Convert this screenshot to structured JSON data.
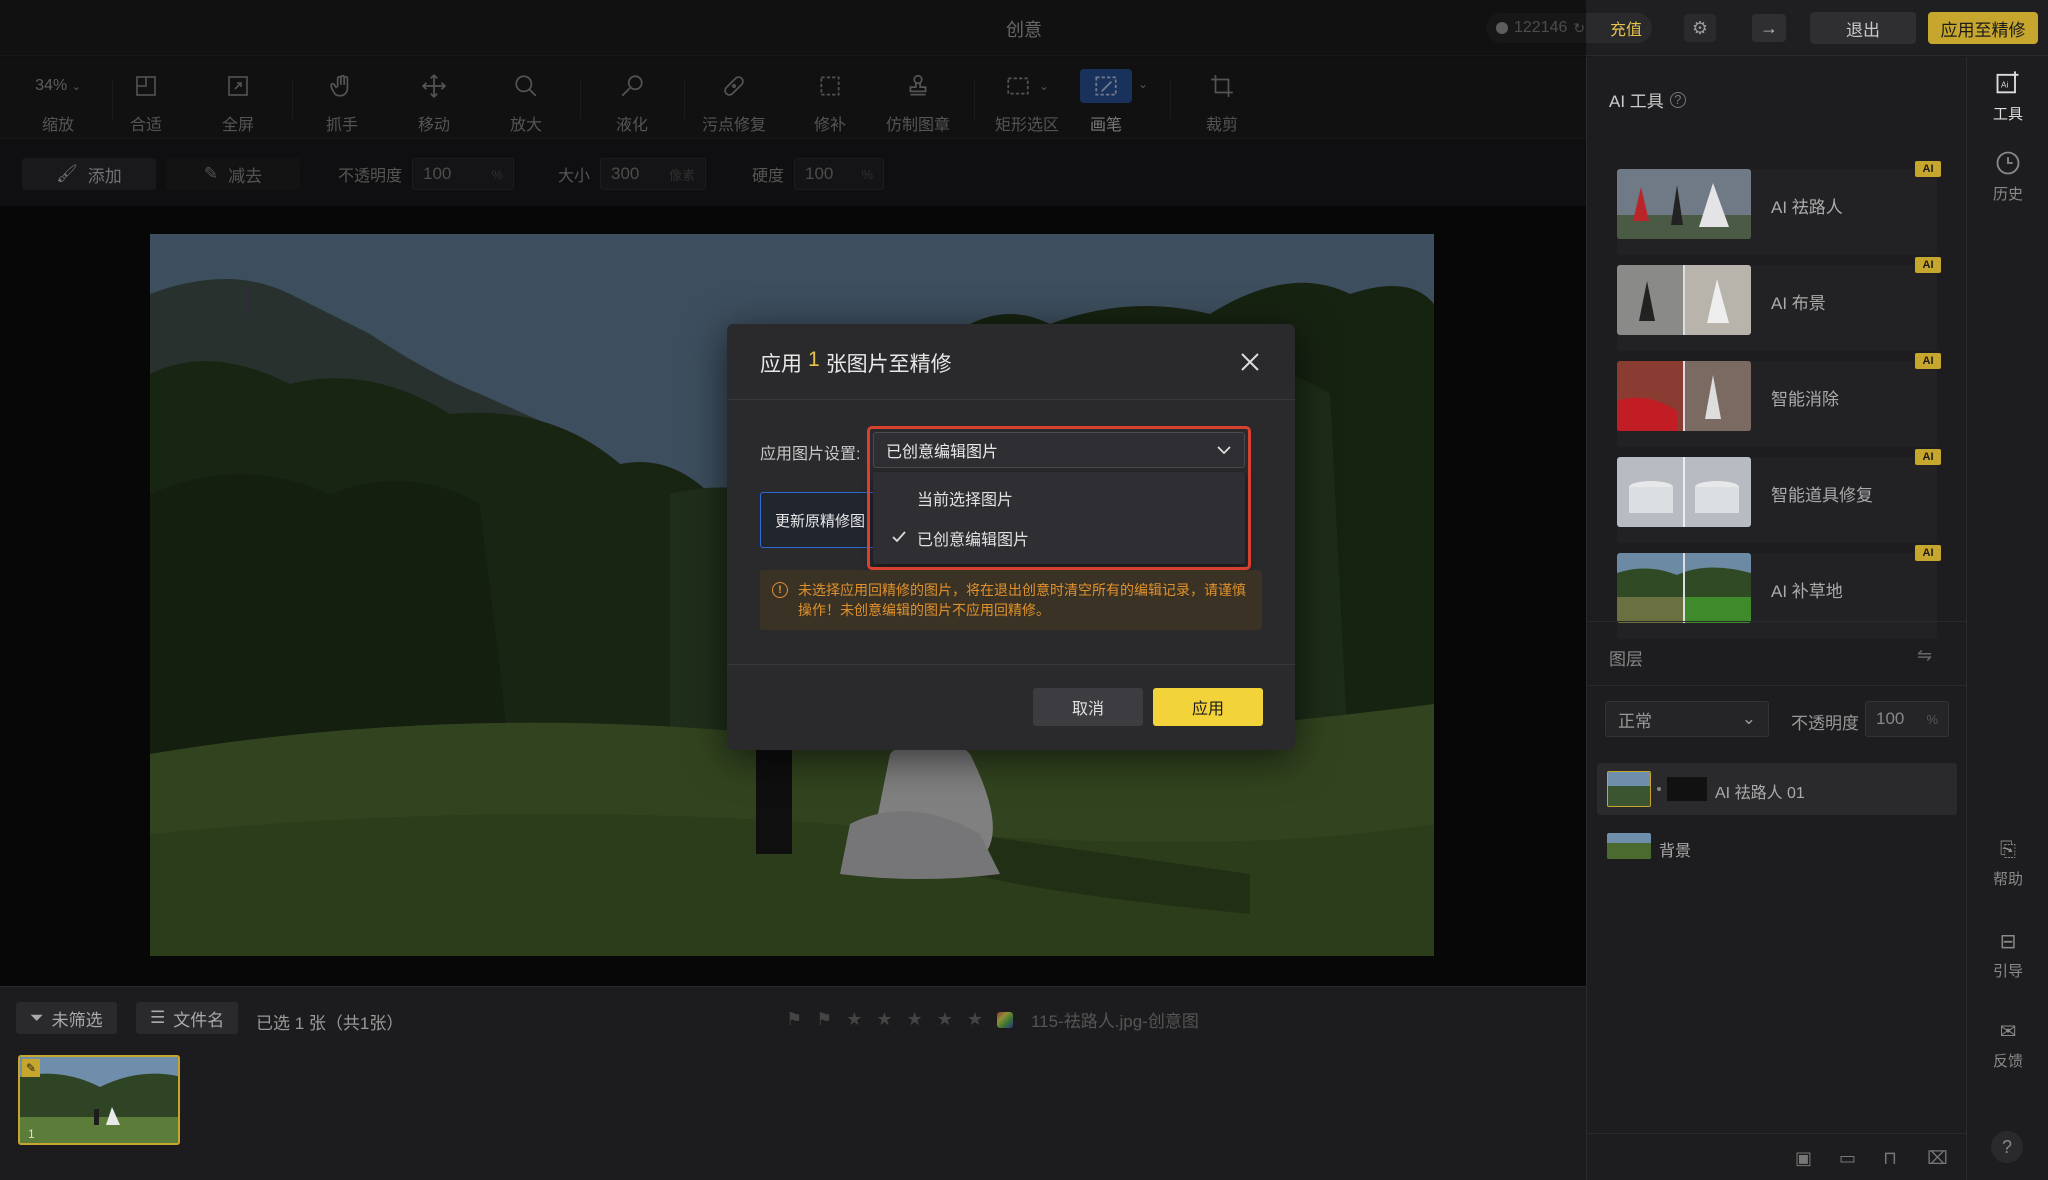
{
  "app": {
    "title": "创意"
  },
  "topbar": {
    "credits": "122146",
    "recharge": "充值",
    "exit": "退出",
    "apply_retouch": "应用至精修"
  },
  "tools": {
    "zoom_value": "34%",
    "zoom": "缩放",
    "fit": "合适",
    "fullscreen": "全屏",
    "grab": "抓手",
    "move": "移动",
    "magnify": "放大",
    "liquify": "液化",
    "spot_heal": "污点修复",
    "patch": "修补",
    "clone_stamp": "仿制图章",
    "rect_select": "矩形选区",
    "brush": "画笔",
    "crop": "裁剪"
  },
  "options": {
    "add": "添加",
    "subtract": "减去",
    "opacity_label": "不透明度",
    "opacity_value": "100",
    "opacity_unit": "%",
    "size_label": "大小",
    "size_value": "300",
    "size_unit": "像素",
    "hardness_label": "硬度",
    "hardness_value": "100",
    "hardness_unit": "%"
  },
  "filmstrip": {
    "filter": "未筛选",
    "sort": "文件名",
    "selected": "已选 1 张（共1张）",
    "filename": "115-祛路人.jpg-创意图",
    "thumb_index": "1"
  },
  "right_panel": {
    "title": "AI 工具",
    "ai_tools": [
      {
        "label": "AI 祛路人",
        "badge": "AI"
      },
      {
        "label": "AI 布景",
        "badge": "AI"
      },
      {
        "label": "智能消除",
        "badge": "AI"
      },
      {
        "label": "智能道具修复",
        "badge": "AI"
      },
      {
        "label": "AI 补草地",
        "badge": "AI"
      }
    ],
    "layers_title": "图层",
    "blend_mode": "正常",
    "opacity_label": "不透明度",
    "opacity_value": "100",
    "opacity_unit": "%",
    "layers": [
      {
        "name": "AI 祛路人 01"
      },
      {
        "name": "背景"
      }
    ]
  },
  "rail": {
    "tools": "工具",
    "history": "历史",
    "help": "帮助",
    "guide": "引导",
    "feedback": "反馈",
    "question": "?"
  },
  "modal": {
    "title_prefix": "应用",
    "title_count": "1",
    "title_suffix": "张图片至精修",
    "setting_label": "应用图片设置:",
    "selected_option": "已创意编辑图片",
    "options": [
      "当前选择图片",
      "已创意编辑图片"
    ],
    "update_button": "更新原精修图",
    "warning": "未选择应用回精修的图片，将在退出创意时清空所有的编辑记录，请谨慎操作！未创意编辑的图片不应用回精修。",
    "cancel": "取消",
    "apply": "应用"
  },
  "colors": {
    "accent_gold": "#c7a62e",
    "apply_yellow": "#f2d33a",
    "highlight_red": "#d8402f",
    "active_blue": "#2e5ca8",
    "warning_orange": "#e0902c"
  }
}
